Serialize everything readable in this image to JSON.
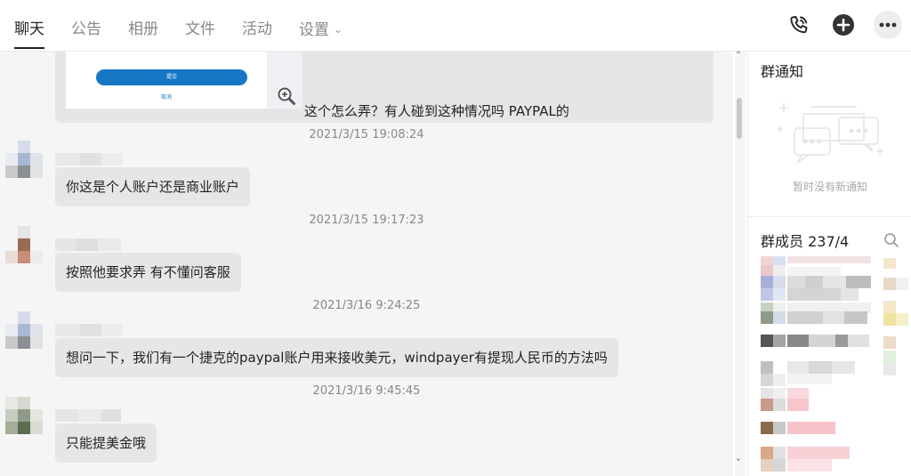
{
  "tabs": [
    {
      "label": "聊天",
      "active": true
    },
    {
      "label": "公告"
    },
    {
      "label": "相册"
    },
    {
      "label": "文件"
    },
    {
      "label": "活动"
    },
    {
      "label": "设置"
    }
  ],
  "header_icons": [
    "phone-icon",
    "add-icon",
    "more-icon"
  ],
  "chat": {
    "image_message": {
      "button_text": "提交",
      "link_text": "取消",
      "caption": "这个怎么弄？有人碰到这种情况吗 PAYPAL的"
    },
    "messages": [
      {
        "time": "2021/3/15 19:08:24",
        "text": "你这是个人账户还是商业账户"
      },
      {
        "time": "2021/3/15 19:17:23",
        "text": "按照他要求弄 有不懂问客服"
      },
      {
        "time": "2021/3/16 9:24:25",
        "text": "想问一下，我们有一个捷克的paypal账户用来接收美元，windpayer有提现人民币的方法吗"
      },
      {
        "time": "2021/3/16 9:45:45",
        "text": "只能提美金哦"
      }
    ]
  },
  "sidebar": {
    "notice_title": "群通知",
    "notice_empty": "暂时没有新通知",
    "members_title": "群成员 237/4"
  },
  "colors": {
    "bubble": "#e6e6e6",
    "chat_bg": "#f5f5f5",
    "accent": "#1877c5"
  }
}
